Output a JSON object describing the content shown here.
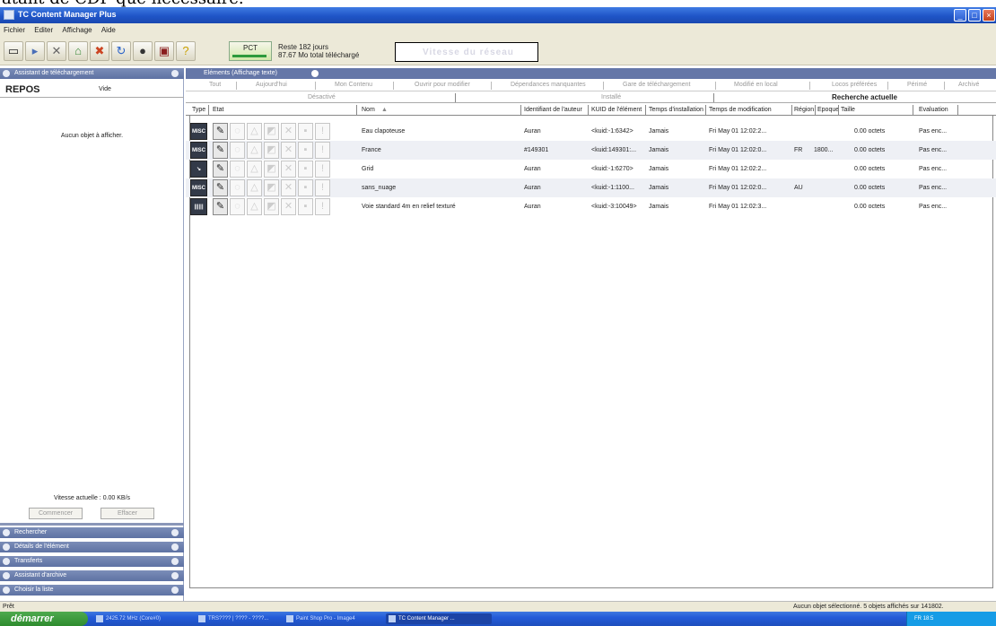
{
  "top_text": "atant de CDP que nécessaire.",
  "window": {
    "title": "TC Content Manager Plus",
    "controls": [
      "_",
      "□",
      "×"
    ]
  },
  "menu": [
    "Fichier",
    "Editer",
    "Affichage",
    "Aide"
  ],
  "toolbar": {
    "pct_label": "PCT",
    "reste_line1": "Reste 182 jours",
    "reste_line2": "87.67 Mo total téléchargé",
    "speed_text": "Vitesse du réseau"
  },
  "left": {
    "assistant_header": "Assistant de téléchargement",
    "repos_label": "REPOS",
    "repos_status": "Vide",
    "empty_text": "Aucun objet à afficher.",
    "speed_text": "Vitesse actuelle : 0.00 KB/s",
    "start_button": "Commencer",
    "clear_button": "Effacer",
    "sections": [
      "Rechercher",
      "Détails de l'élément",
      "Transferts",
      "Assistant d'archive",
      "Choisir la liste"
    ]
  },
  "main": {
    "header": "Eléments (Affichage texte)",
    "filters": [
      "Tout",
      "Aujourd'hui",
      "Mon Contenu",
      "Ouvrir pour modifier",
      "Dépendances manquantes",
      "Gare de téléchargement",
      "Modifié en local",
      "Locos préférées",
      "Périmé",
      "Archivé"
    ],
    "group_desactive": "Désactivé",
    "group_installe": "Installé",
    "group_recherche": "Recherche actuelle",
    "columns": [
      "Type",
      "Etat",
      "Nom",
      "Identifiant de l'auteur",
      "KUID de l'élément",
      "Temps d'installation",
      "Temps de modification",
      "Région",
      "Epoque",
      "Taille",
      "Evaluation"
    ],
    "rows": [
      {
        "type": "MISC",
        "name": "Eau clapoteuse",
        "author": "Auran",
        "kuid": "<kuid:-1:6342>",
        "installed": "Jamais",
        "modified": "Fri May 01 12:02:2...",
        "region": "",
        "epoch": "",
        "size": "0.00 octets",
        "rating": "Pas enc..."
      },
      {
        "type": "MISC",
        "name": "France",
        "author": "#149301",
        "kuid": "<kuid:149301:...",
        "installed": "Jamais",
        "modified": "Fri May 01 12:02:0...",
        "region": "FR",
        "epoch": "1800...",
        "size": "0.00 octets",
        "rating": "Pas enc..."
      },
      {
        "type": "",
        "name": "Grid",
        "author": "Auran",
        "kuid": "<kuid:-1:6270>",
        "installed": "Jamais",
        "modified": "Fri May 01 12:02:2...",
        "region": "",
        "epoch": "",
        "size": "0.00 octets",
        "rating": "Pas enc..."
      },
      {
        "type": "MISC",
        "name": "sans_nuage",
        "author": "Auran",
        "kuid": "<kuid:-1:1100...",
        "installed": "Jamais",
        "modified": "Fri May 01 12:02:0...",
        "region": "AU",
        "epoch": "",
        "size": "0.00 octets",
        "rating": "Pas enc..."
      },
      {
        "type": "||||||",
        "name": "Voie standard 4m en relief texturé",
        "author": "Auran",
        "kuid": "<kuid:-3:10049>",
        "installed": "Jamais",
        "modified": "Fri May 01 12:02:3...",
        "region": "",
        "epoch": "",
        "size": "0.00 octets",
        "rating": "Pas enc..."
      }
    ]
  },
  "status": {
    "left": "Prêt",
    "right": "Aucun objet sélectionné. 5 objets affichés sur 141802."
  },
  "taskbar": {
    "start": "démarrer",
    "tasks": [
      "2425.72 MHz (Core#0)",
      "TRS???? | ???? - ????...",
      "Paint Shop Pro - Image4",
      "TC Content Manager ..."
    ],
    "tray": "FR   18:5"
  }
}
